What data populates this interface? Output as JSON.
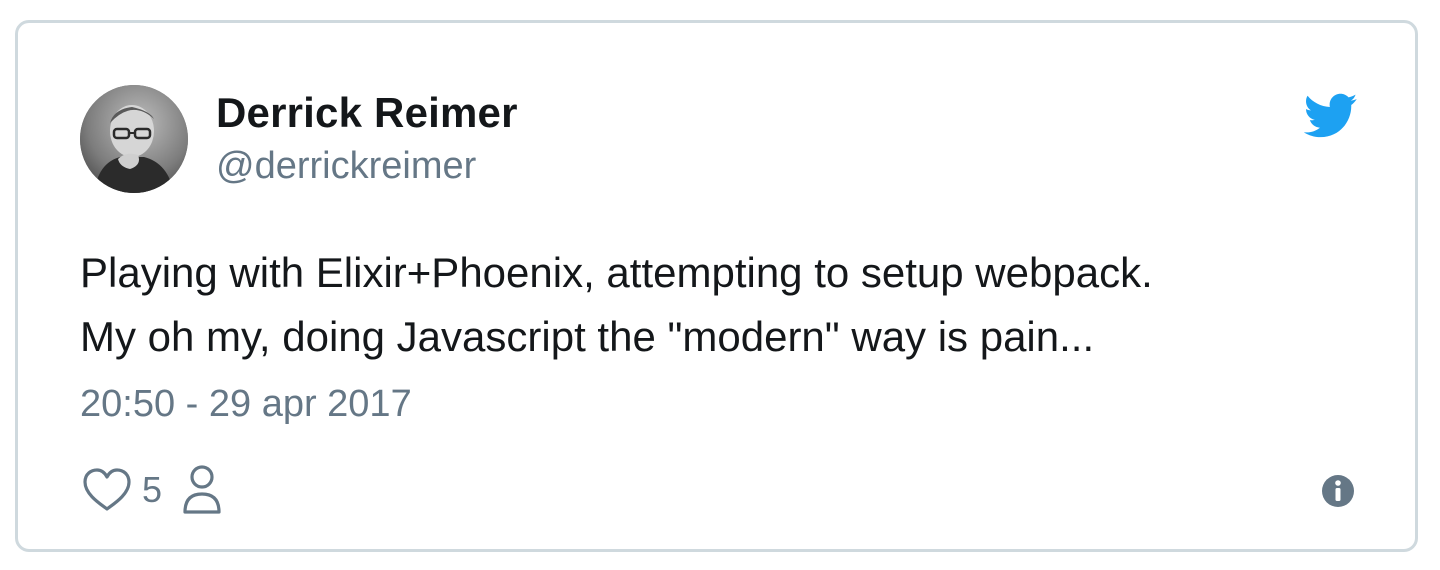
{
  "tweet": {
    "author": {
      "display_name": "Derrick Reimer",
      "handle": "@derrickreimer"
    },
    "text_lines": [
      "Playing with Elixir+Phoenix, attempting to setup webpack.",
      "My oh my, doing Javascript the \"modern\" way is pain..."
    ],
    "timestamp": "20:50 - 29 apr 2017",
    "likes": "5"
  },
  "icons": {
    "brand": "twitter-bird-icon",
    "like": "heart-icon",
    "people": "person-icon",
    "info": "info-icon"
  },
  "colors": {
    "brand": "#1da1f2",
    "text": "#14171a",
    "muted": "#657786",
    "border": "#cfd9de"
  }
}
